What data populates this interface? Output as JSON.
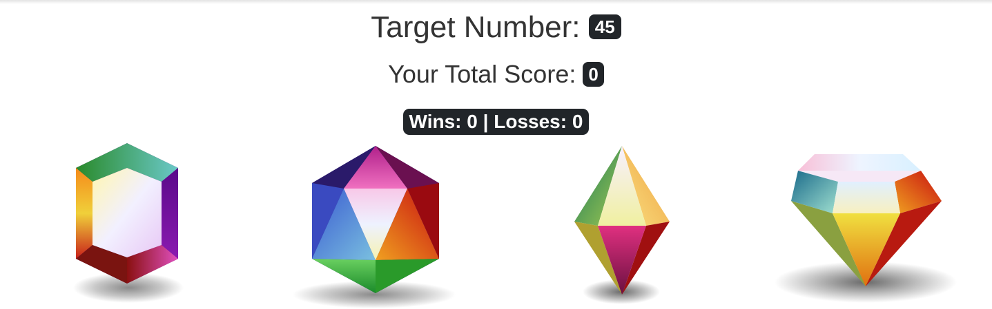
{
  "game": {
    "target_label": "Target Number:",
    "target_value": "45",
    "score_label": "Your Total Score:",
    "score_value": "0",
    "record": "Wins: 0 | Losses: 0"
  },
  "crystals": [
    {
      "name": "crystal-hexagonal-prism",
      "icon": "hexagon-gem-icon"
    },
    {
      "name": "crystal-icosahedron",
      "icon": "icosahedron-gem-icon"
    },
    {
      "name": "crystal-octahedron",
      "icon": "octahedron-gem-icon"
    },
    {
      "name": "crystal-brilliant-cut",
      "icon": "diamond-gem-icon"
    }
  ]
}
